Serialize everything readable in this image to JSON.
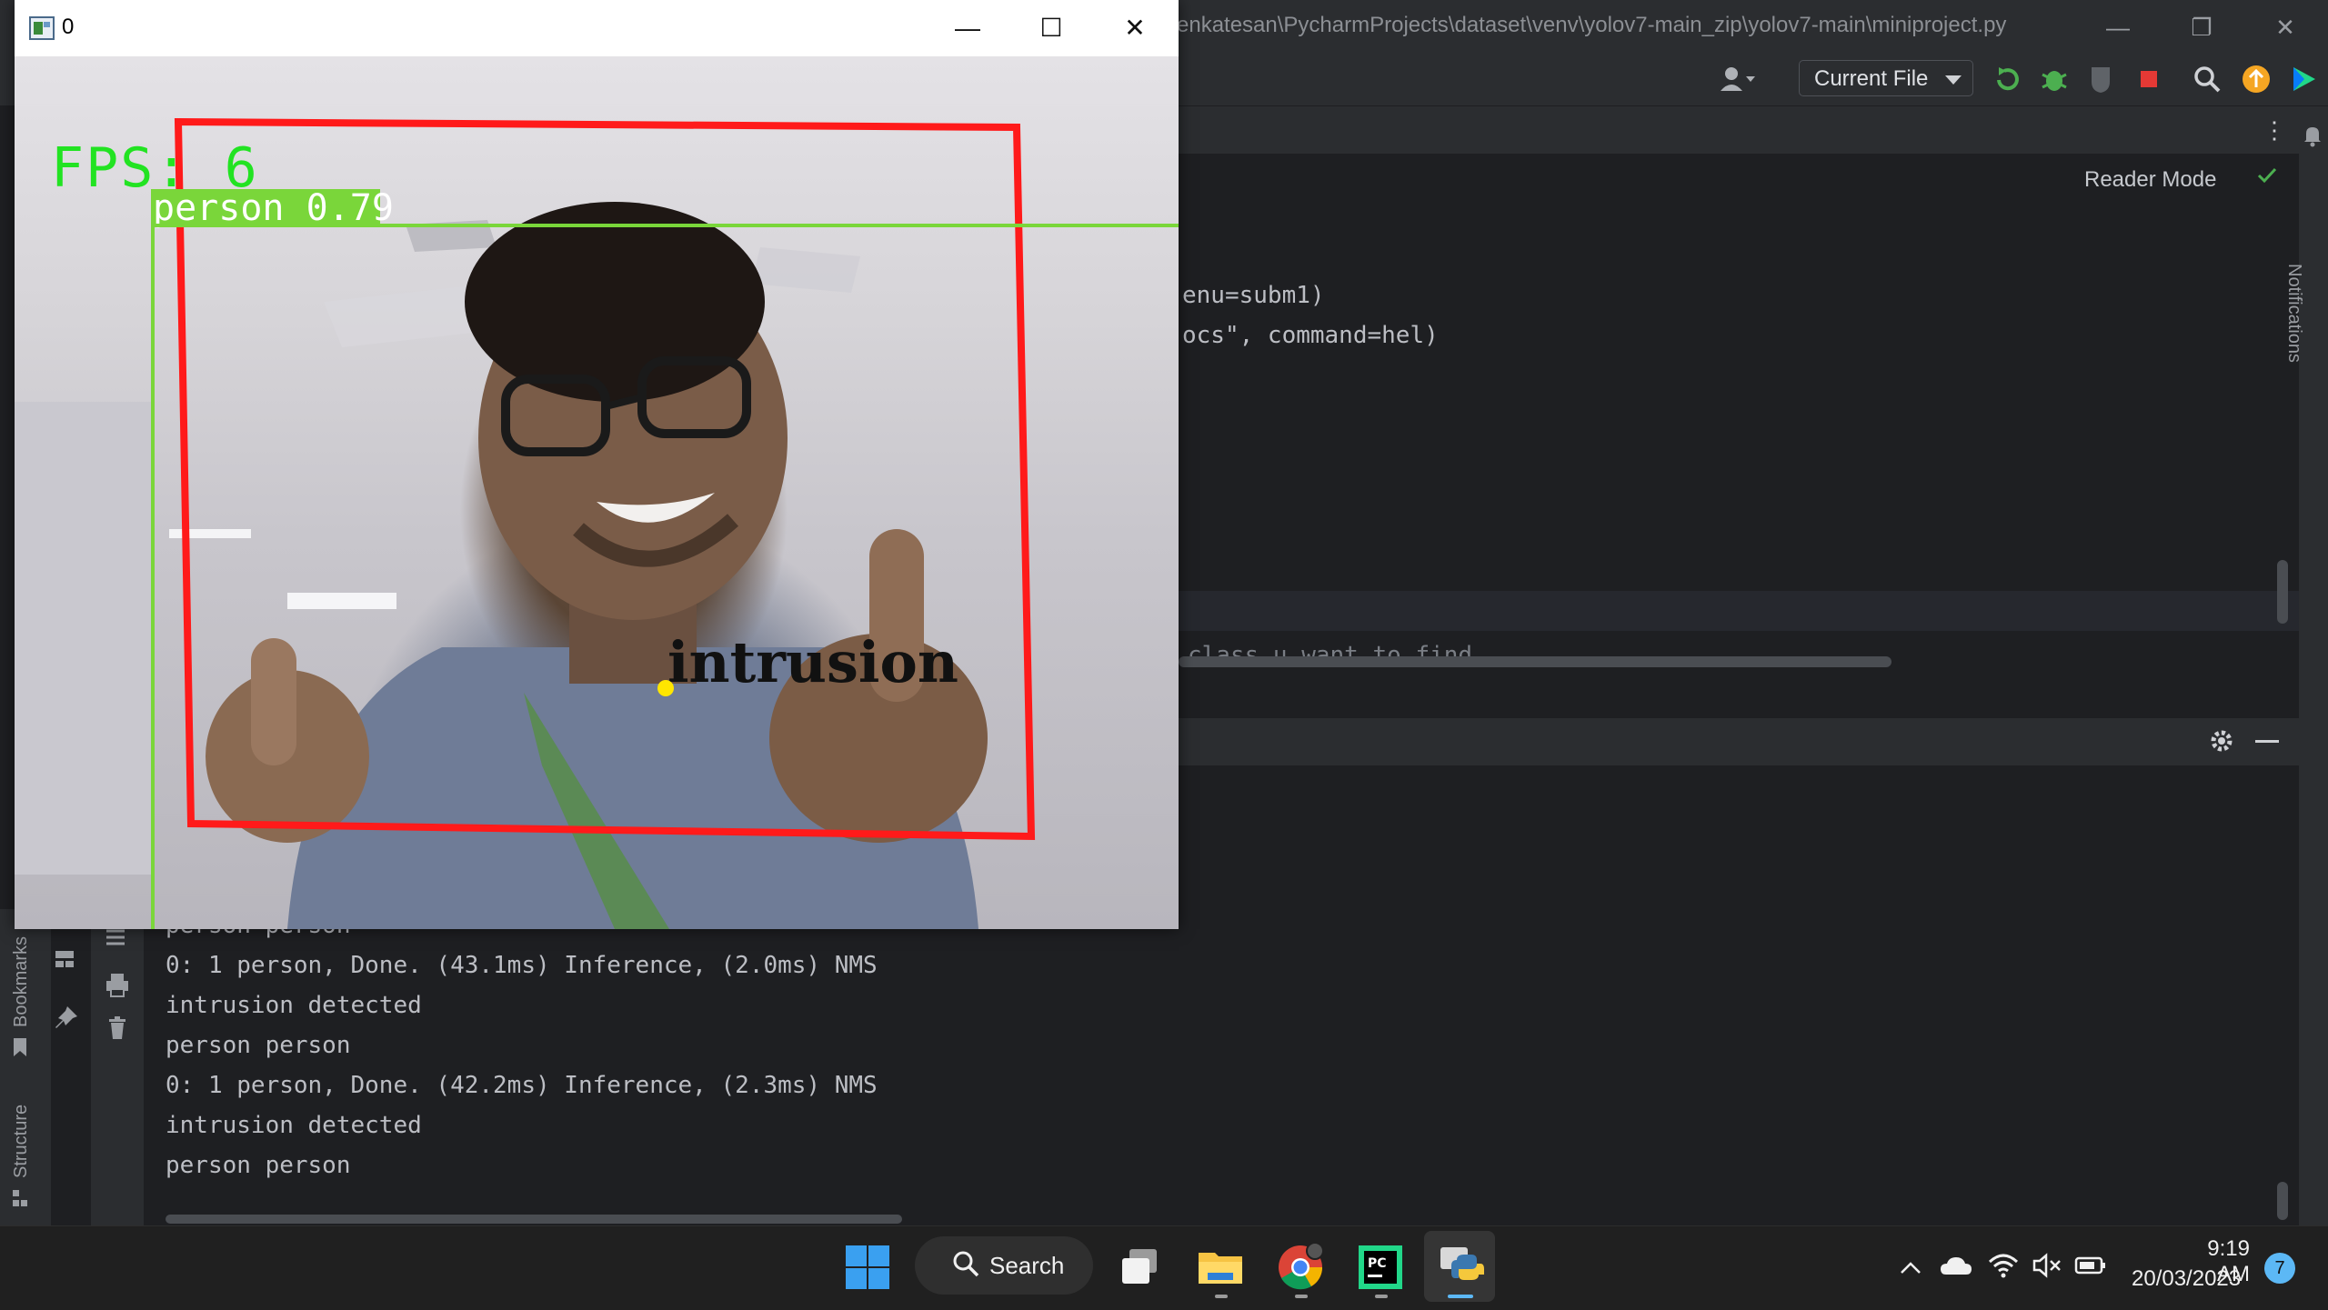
{
  "ide": {
    "path": "enkatesan\\PycharmProjects\\dataset\\venv\\yolov7-main_zip\\yolov7-main\\miniproject.py",
    "run_config": "Current File",
    "reader_mode": "Reader Mode",
    "notifications": "Notifications",
    "bookmarks": "Bookmarks",
    "structure": "Structure",
    "code_lines": [
      "enu=subm1)",
      "ocs\", command=hel)"
    ],
    "code_comment": "class u want to find",
    "console_lines": [
      "person person",
      "0: 1 person, Done. (43.1ms) Inference, (2.0ms) NMS",
      "intrusion detected",
      "person person",
      "0: 1 person, Done. (42.2ms) Inference, (2.3ms) NMS",
      "intrusion detected",
      "person person"
    ],
    "accent_colors": {
      "run": "#4caf50",
      "stop": "#e53935",
      "update": "#f5a623"
    }
  },
  "camera_window": {
    "title": "0",
    "fps": "FPS: 6",
    "detection_label": "person 0.79",
    "alert_text": "intrusion",
    "colors": {
      "fps": "#22e322",
      "detection_box": "#7ad63a",
      "intrusion_zone": "#ff1a1a",
      "centroid": "#ffe600"
    }
  },
  "taskbar": {
    "search_label": "Search",
    "apps": [
      "windows-start-icon",
      "task-view-icon",
      "file-explorer-icon",
      "chrome-icon",
      "pycharm-icon",
      "python-icon"
    ],
    "time": "9:19 AM",
    "date": "20/03/2023",
    "notification_count": "7"
  }
}
